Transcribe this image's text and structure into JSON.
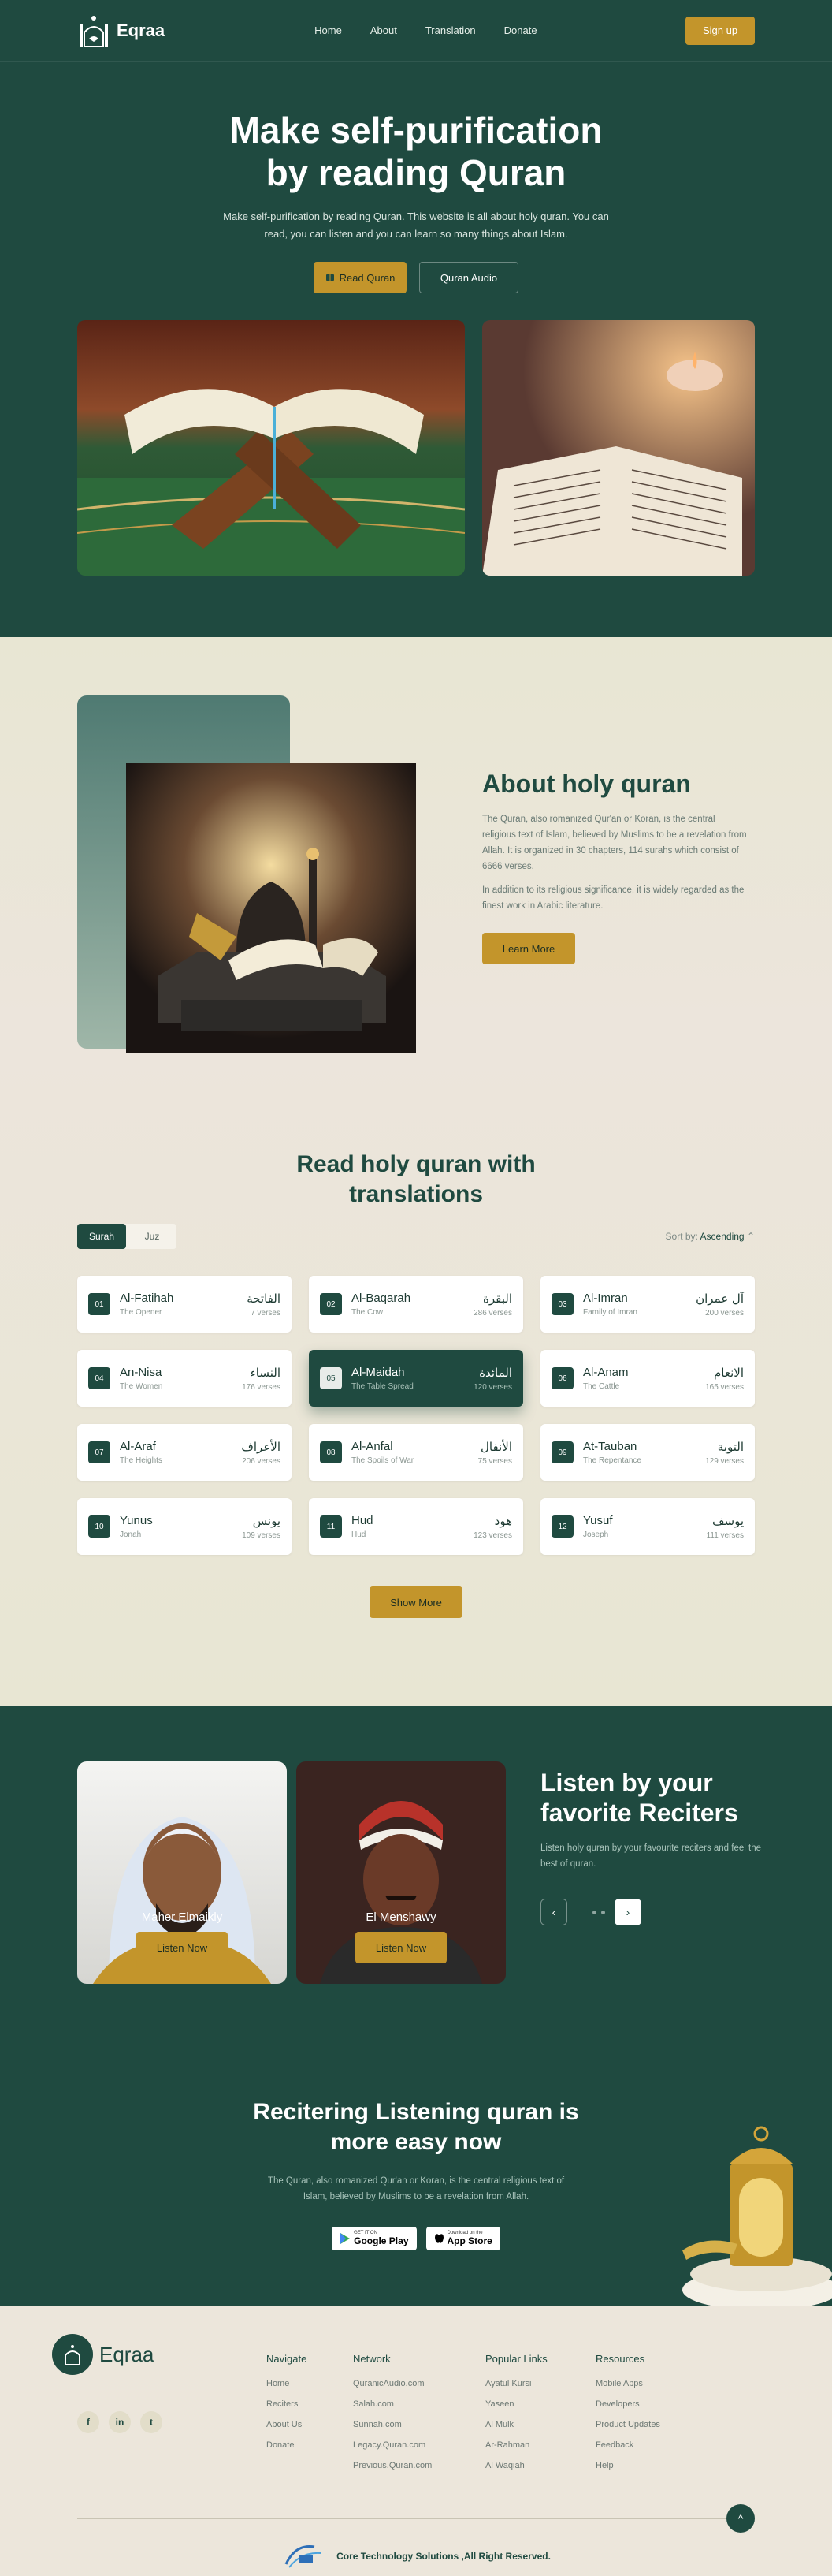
{
  "nav": {
    "brand": "Eqraa",
    "links": [
      "Home",
      "About",
      "Translation",
      "Donate"
    ],
    "signup": "Sign up"
  },
  "hero": {
    "title_line1": "Make self-purification",
    "title_line2": "by reading Quran",
    "subtitle": "Make self-purification by reading Quran. This website is all about holy quran. You can read, you can listen and you can learn so many things about Islam.",
    "read_btn": "Read Quran",
    "audio_btn": "Quran Audio"
  },
  "about": {
    "title": "About holy quran",
    "p1": "The Quran, also romanized Qur'an or Koran, is the central religious text of Islam, believed by Muslims to be a revelation from Allah. It is organized in 30 chapters, 114 surahs which consist of 6666 verses.",
    "p2": "In addition to its religious significance, it is widely regarded as the finest work in Arabic literature.",
    "button": "Learn More"
  },
  "translations": {
    "title_line1": "Read holy quran with",
    "title_line2": "translations",
    "tabs": [
      "Surah",
      "Juz"
    ],
    "sort_label": "Sort by:",
    "sort_value": "Ascending",
    "show_more": "Show More",
    "surahs": [
      {
        "num": "01",
        "name": "Al-Fatihah",
        "meaning": "The Opener",
        "arabic": "الفاتحة",
        "verses": "7 verses"
      },
      {
        "num": "02",
        "name": "Al-Baqarah",
        "meaning": "The Cow",
        "arabic": "البقرة",
        "verses": "286 verses"
      },
      {
        "num": "03",
        "name": "Al-Imran",
        "meaning": "Family of Imran",
        "arabic": "آل عمران",
        "verses": "200 verses"
      },
      {
        "num": "04",
        "name": "An-Nisa",
        "meaning": "The Women",
        "arabic": "النساء",
        "verses": "176 verses"
      },
      {
        "num": "05",
        "name": "Al-Maidah",
        "meaning": "The Table Spread",
        "arabic": "المائدة",
        "verses": "120 verses"
      },
      {
        "num": "06",
        "name": "Al-Anam",
        "meaning": "The Cattle",
        "arabic": "الانعام",
        "verses": "165 verses"
      },
      {
        "num": "07",
        "name": "Al-Araf",
        "meaning": "The Heights",
        "arabic": "الأعراف",
        "verses": "206 verses"
      },
      {
        "num": "08",
        "name": "Al-Anfal",
        "meaning": "The Spoils of War",
        "arabic": "الأنفال",
        "verses": "75 verses"
      },
      {
        "num": "09",
        "name": "At-Tauban",
        "meaning": "The Repentance",
        "arabic": "التوبة",
        "verses": "129 verses"
      },
      {
        "num": "10",
        "name": "Yunus",
        "meaning": "Jonah",
        "arabic": "يونس",
        "verses": "109 verses"
      },
      {
        "num": "11",
        "name": "Hud",
        "meaning": "Hud",
        "arabic": "هود",
        "verses": "123 verses"
      },
      {
        "num": "12",
        "name": "Yusuf",
        "meaning": "Joseph",
        "arabic": "يوسف",
        "verses": "111 verses"
      }
    ],
    "active_index": 4
  },
  "reciters": {
    "cards": [
      {
        "name": "Maher Elmaikly",
        "button": "Listen Now"
      },
      {
        "name": "El Menshawy",
        "button": "Listen Now"
      }
    ],
    "title_line1": "Listen by your",
    "title_line2": "favorite Reciters",
    "subtitle": "Listen holy quran by your favourite reciters and feel the best of quran.",
    "prev_icon": "‹",
    "next_icon": "›"
  },
  "app": {
    "title_line1": "Recitering Listening quran is",
    "title_line2": "more easy now",
    "subtitle_line1": "The Quran, also romanized Qur'an or Koran, is the central religious text of",
    "subtitle_line2": "Islam, believed by Muslims to be a revelation from Allah.",
    "google_small": "GET IT ON",
    "google_big": "Google Play",
    "apple_small": "Download on the",
    "apple_big": "App Store"
  },
  "footer": {
    "brand": "Eqraa",
    "socials": [
      "f",
      "in",
      "t"
    ],
    "columns": [
      {
        "title": "Navigate",
        "links": [
          "Home",
          "Reciters",
          "About Us",
          "Donate"
        ]
      },
      {
        "title": "Network",
        "links": [
          "QuranicAudio.com",
          "Salah.com",
          "Sunnah.com",
          "Legacy.Quran.com",
          "Previous.Quran.com"
        ]
      },
      {
        "title": "Popular Links",
        "links": [
          "Ayatul Kursi",
          "Yaseen",
          "Al Mulk",
          "Ar-Rahman",
          "Al Waqiah"
        ]
      },
      {
        "title": "Resources",
        "links": [
          "Mobile Apps",
          "Developers",
          "Product Updates",
          "Feedback",
          "Help"
        ]
      }
    ],
    "to_top": "^",
    "copyright": "Core Technology Solutions ,All Right Reserved."
  },
  "colors": {
    "primary": "#1f4a40",
    "accent": "#c3952b",
    "cream": "#e9e6d6"
  }
}
